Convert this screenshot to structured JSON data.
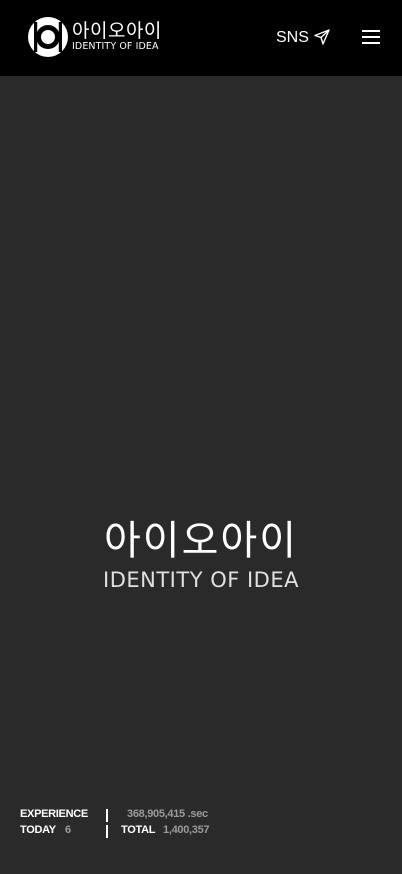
{
  "header": {
    "logo": {
      "korean": "아이오아이",
      "english": "IDENTITY OF IDEA"
    },
    "sns_label": "SNS",
    "sns_icon": "send-icon",
    "menu_icon": "hamburger-menu-icon"
  },
  "hero": {
    "korean": "아이오아이",
    "english": "IDENTITY OF IDEA"
  },
  "stats": {
    "experience_label": "EXPERIENCE",
    "experience_value": "368,905,415 .sec",
    "today_label": "TODAY",
    "today_value": "6",
    "total_label": "TOTAL",
    "total_value": "1,400,357"
  },
  "colors": {
    "header_bg": "#000000",
    "page_bg": "#2a2a2a",
    "text": "#ffffff",
    "muted": "#9a9a9a"
  }
}
